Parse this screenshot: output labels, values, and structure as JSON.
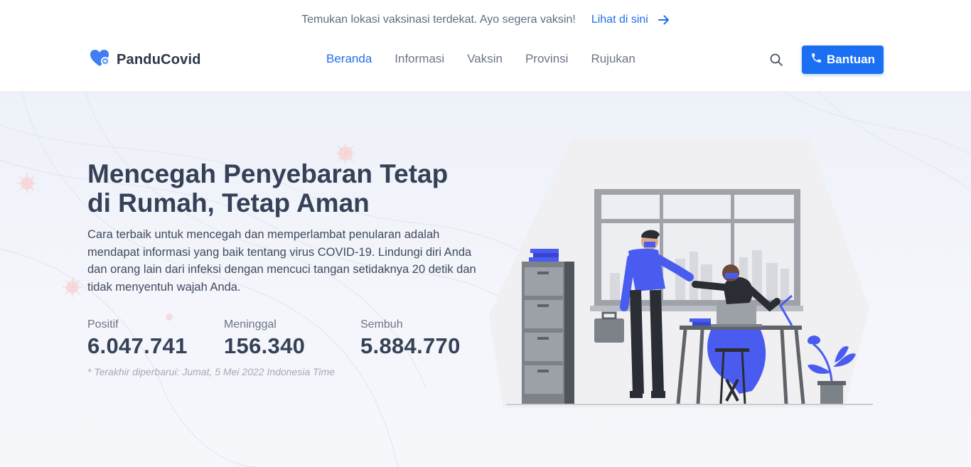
{
  "announcement": {
    "text": "Temukan lokasi vaksinasi terdekat. Ayo segera vaksin!",
    "link_label": "Lihat di sini"
  },
  "brand": {
    "name": "PanduCovid"
  },
  "nav": {
    "items": [
      {
        "label": "Beranda",
        "active": true
      },
      {
        "label": "Informasi",
        "active": false
      },
      {
        "label": "Vaksin",
        "active": false
      },
      {
        "label": "Provinsi",
        "active": false
      },
      {
        "label": "Rujukan",
        "active": false
      }
    ],
    "help_label": "Bantuan"
  },
  "hero": {
    "title_line1": "Mencegah Penyebaran Tetap",
    "title_line2": "di Rumah, Tetap Aman",
    "description": "Cara terbaik untuk mencegah dan memperlambat penularan adalah mendapat informasi yang baik tentang virus COVID-19. Lindungi diri Anda dan orang lain dari infeksi dengan mencuci tangan setidaknya 20 detik dan tidak menyentuh wajah Anda.",
    "stats": [
      {
        "label": "Positif",
        "value": "6.047.741"
      },
      {
        "label": "Meninggal",
        "value": "156.340"
      },
      {
        "label": "Sembuh",
        "value": "5.884.770"
      }
    ],
    "updated": "* Terakhir diperbarui: Jumat, 5 Mei 2022 Indonesia Time"
  },
  "colors": {
    "accent": "#1a6ff2",
    "figure_blue": "#4a5cf0",
    "text_dark": "#364157"
  }
}
